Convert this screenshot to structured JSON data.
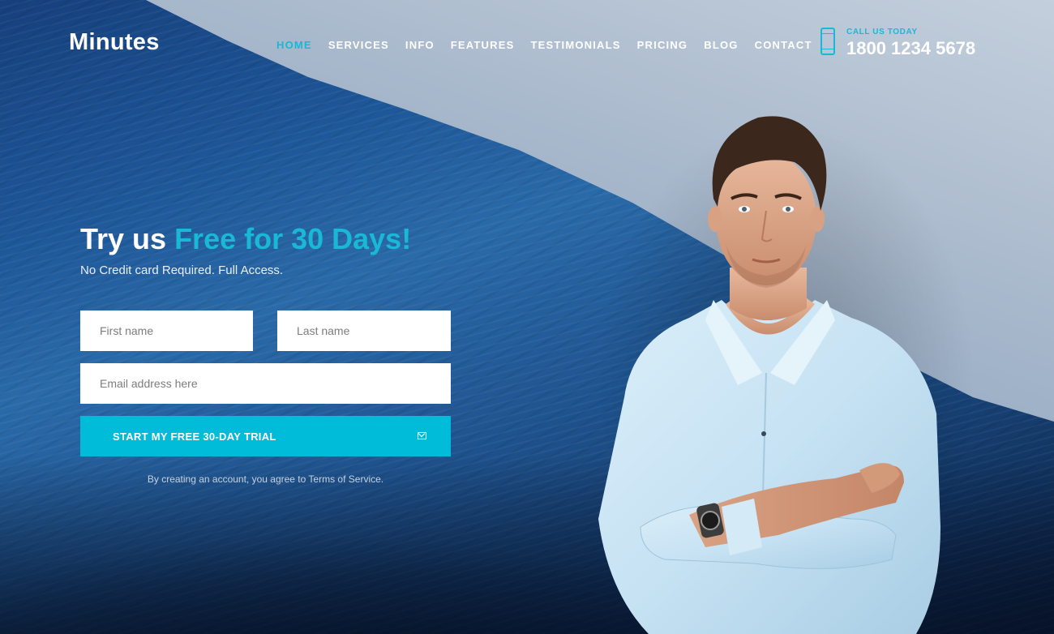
{
  "brand": {
    "logo": "Minutes"
  },
  "nav": {
    "items": [
      {
        "label": "HOME",
        "active": true
      },
      {
        "label": "SERVICES",
        "active": false
      },
      {
        "label": "INFO",
        "active": false
      },
      {
        "label": "FEATURES",
        "active": false
      },
      {
        "label": "TESTIMONIALS",
        "active": false
      },
      {
        "label": "PRICING",
        "active": false
      },
      {
        "label": "BLOG",
        "active": false
      },
      {
        "label": "CONTACT",
        "active": false
      }
    ]
  },
  "contact": {
    "label": "CALL US TODAY",
    "phone": "1800 1234 5678",
    "icon": "smartphone-icon"
  },
  "hero": {
    "headline_prefix": "Try us ",
    "headline_accent": "Free for 30 Days!",
    "subhead": "No Credit card Required. Full Access."
  },
  "form": {
    "first_name_placeholder": "First name",
    "last_name_placeholder": "Last name",
    "email_placeholder": "Email address here",
    "submit_label": "START MY FREE 30-DAY TRIAL",
    "submit_icon": "envelope-icon",
    "terms": "By creating an account, you agree to Terms of Service."
  },
  "colors": {
    "accent": "#00bcd8",
    "text_light": "#ffffff",
    "wave_blue": "#1d5597"
  }
}
